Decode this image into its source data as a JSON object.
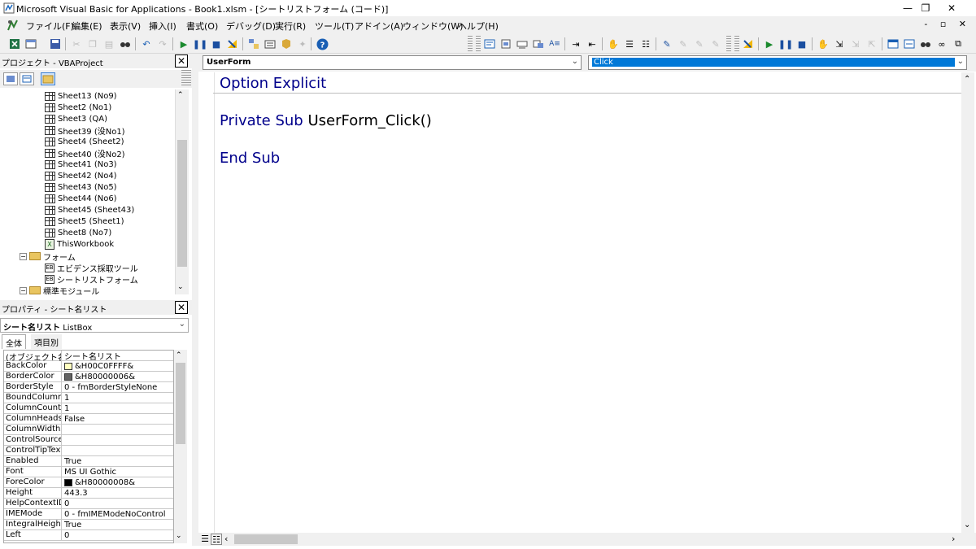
{
  "window": {
    "title": "Microsoft Visual Basic for Applications - Book1.xlsm - [シートリストフォーム (コード)]",
    "minimize": "—",
    "restore": "❐",
    "close": "✕"
  },
  "menu": {
    "items": [
      "ファイル(F)",
      "編集(E)",
      "表示(V)",
      "挿入(I)",
      "書式(O)",
      "デバッグ(D)",
      "実行(R)",
      "ツール(T)",
      "アドイン(A)",
      "ウィンドウ(W)",
      "ヘルプ(H)"
    ],
    "mdi_buttons": "- ▫ ✕"
  },
  "project": {
    "title": "プロジェクト - VBAProject",
    "close": "✕",
    "tree": [
      {
        "label": "Sheet13 (No9)",
        "type": "sheet"
      },
      {
        "label": "Sheet2 (No1)",
        "type": "sheet"
      },
      {
        "label": "Sheet3 (QA)",
        "type": "sheet"
      },
      {
        "label": "Sheet39 (没No1)",
        "type": "sheet"
      },
      {
        "label": "Sheet4 (Sheet2)",
        "type": "sheet"
      },
      {
        "label": "Sheet40 (没No2)",
        "type": "sheet"
      },
      {
        "label": "Sheet41 (No3)",
        "type": "sheet"
      },
      {
        "label": "Sheet42 (No4)",
        "type": "sheet"
      },
      {
        "label": "Sheet43 (No5)",
        "type": "sheet"
      },
      {
        "label": "Sheet44 (No6)",
        "type": "sheet"
      },
      {
        "label": "Sheet45 (Sheet43)",
        "type": "sheet"
      },
      {
        "label": "Sheet5 (Sheet1)",
        "type": "sheet"
      },
      {
        "label": "Sheet8 (No7)",
        "type": "sheet"
      },
      {
        "label": "ThisWorkbook",
        "type": "workbook"
      },
      {
        "label": "フォーム",
        "type": "folder"
      },
      {
        "label": "エビデンス採取ツール",
        "type": "form"
      },
      {
        "label": "シートリストフォーム",
        "type": "form"
      },
      {
        "label": "標準モジュール",
        "type": "folder"
      }
    ]
  },
  "properties": {
    "title": "プロパティ - シート名リスト",
    "close": "✕",
    "object_name": "シート名リスト",
    "object_type": "ListBox",
    "tabs": [
      "全体",
      "項目別"
    ],
    "rows": [
      {
        "name": "(オブジェクト名)",
        "value": "シート名リスト"
      },
      {
        "name": "BackColor",
        "value": "&H00C0FFFF&",
        "swatch": "#ffffc0"
      },
      {
        "name": "BorderColor",
        "value": "&H80000006&",
        "swatch": "#646464"
      },
      {
        "name": "BorderStyle",
        "value": "0 - fmBorderStyleNone"
      },
      {
        "name": "BoundColumn",
        "value": "1"
      },
      {
        "name": "ColumnCount",
        "value": "1"
      },
      {
        "name": "ColumnHeads",
        "value": "False"
      },
      {
        "name": "ColumnWidths",
        "value": ""
      },
      {
        "name": "ControlSource",
        "value": ""
      },
      {
        "name": "ControlTipText",
        "value": ""
      },
      {
        "name": "Enabled",
        "value": "True"
      },
      {
        "name": "Font",
        "value": "MS UI Gothic"
      },
      {
        "name": "ForeColor",
        "value": "&H80000008&",
        "swatch": "#000000"
      },
      {
        "name": "Height",
        "value": "443.3"
      },
      {
        "name": "HelpContextID",
        "value": "0"
      },
      {
        "name": "IMEMode",
        "value": "0 - fmIMEModeNoControl"
      },
      {
        "name": "IntegralHeight",
        "value": "True"
      },
      {
        "name": "Left",
        "value": "0"
      }
    ]
  },
  "code": {
    "object_combo": "UserForm",
    "proc_combo": "Click",
    "lines": {
      "option_kw": "Option Explicit",
      "private_kw": "Private Sub",
      "proc_name": "UserForm_Click()",
      "end_kw": "End Sub"
    }
  },
  "colors": {
    "keyword": "#00008b",
    "selection": "#0078d7",
    "background": "#f0f0f0"
  }
}
